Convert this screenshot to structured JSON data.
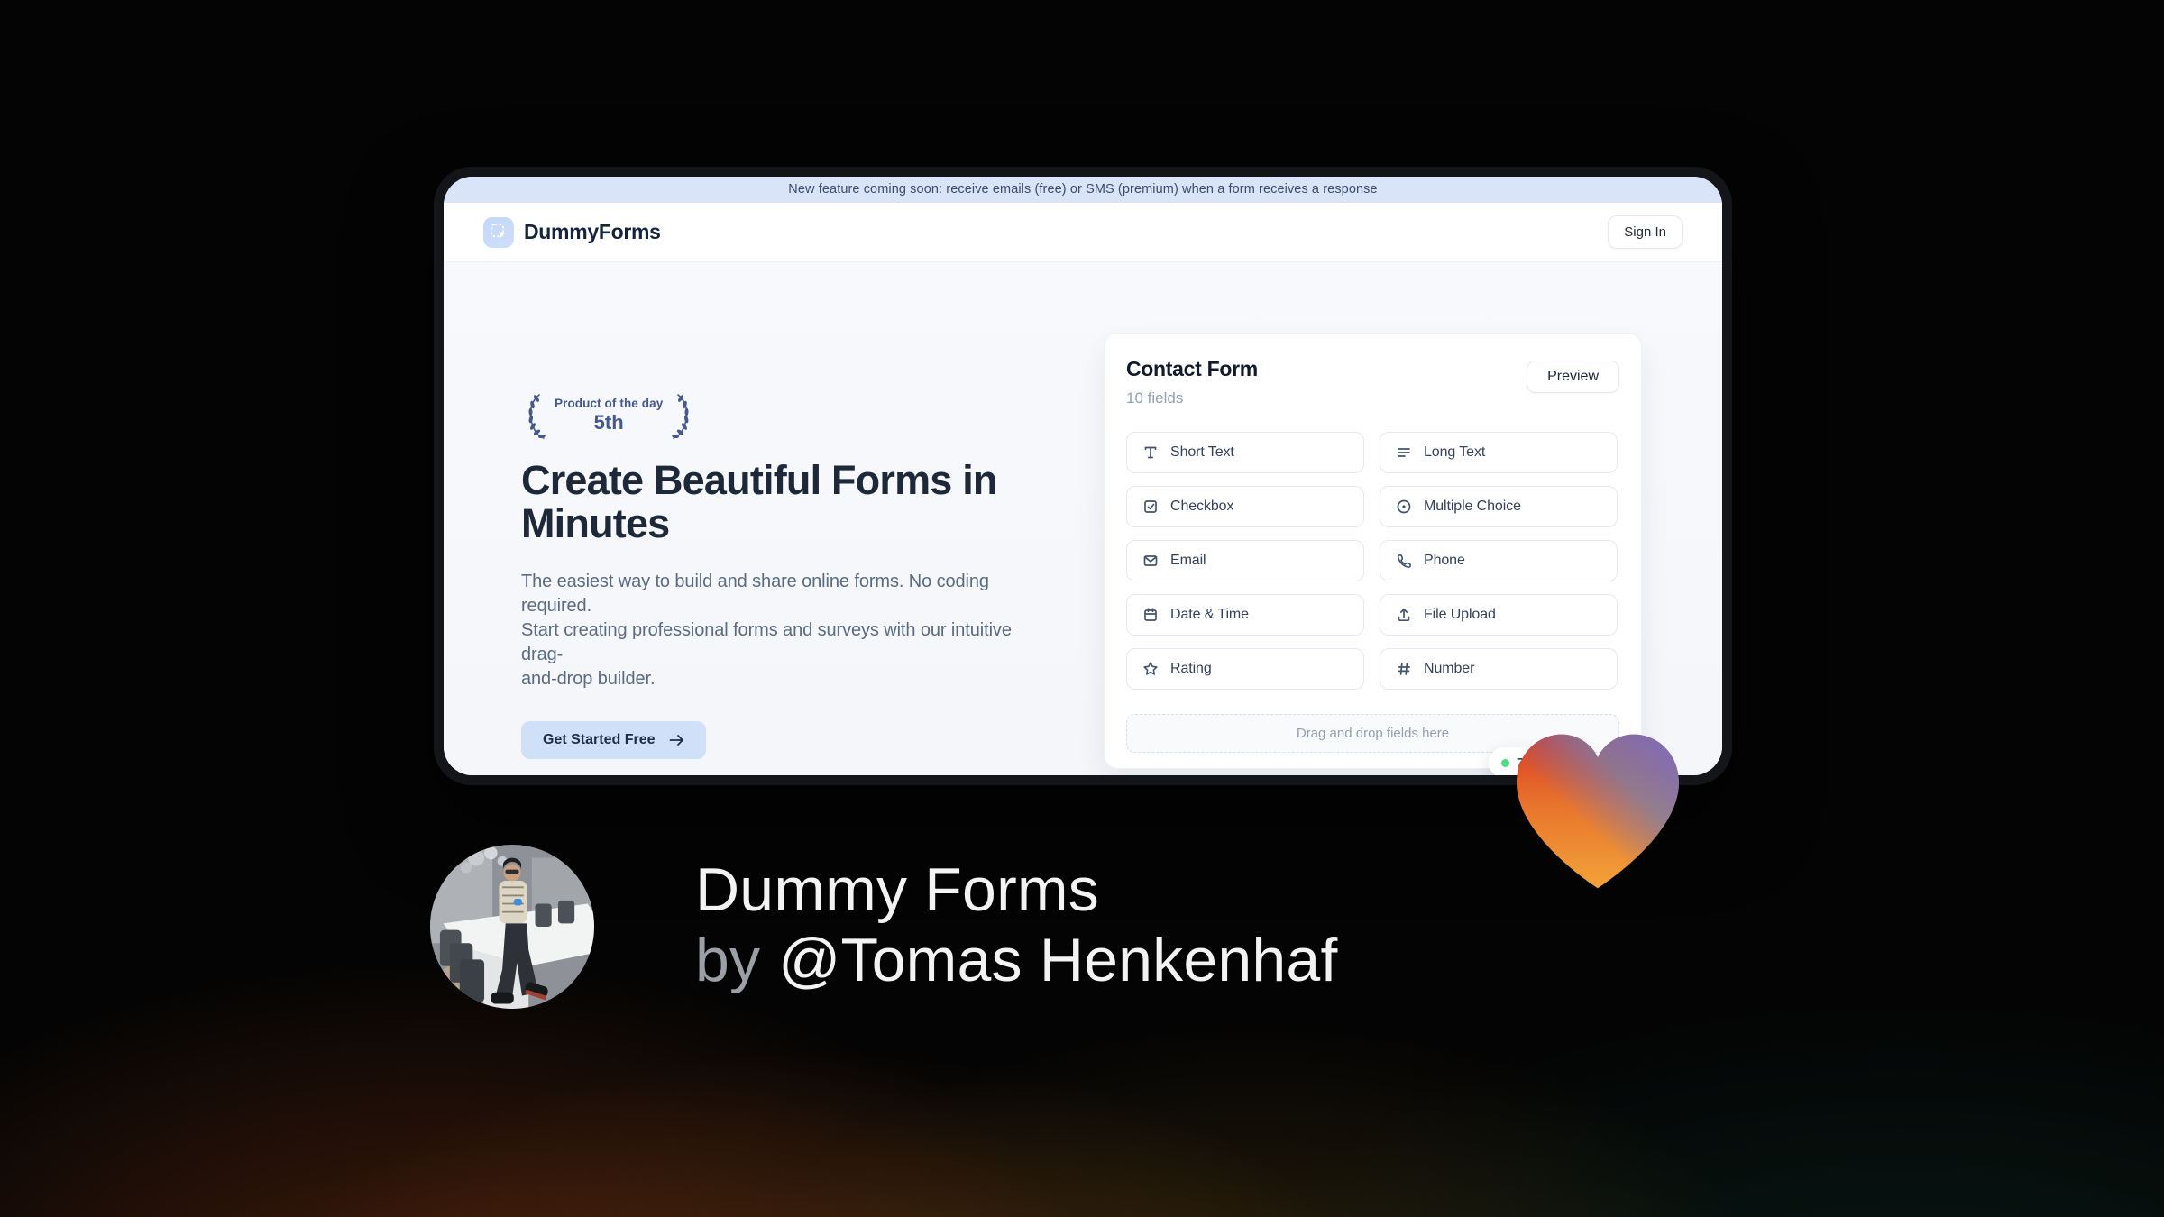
{
  "window": {
    "banner": {
      "text": "New feature coming soon: receive emails (free) or SMS (premium) when a form receives a response",
      "bg_color": "#d9e4f9",
      "text_color": "#3c4d6b"
    },
    "header": {
      "brand": "DummyForms",
      "sign_in_label": "Sign In"
    },
    "hero": {
      "award": {
        "title": "Product of the day",
        "rank": "5th",
        "color": "#46598c"
      },
      "heading": "Create Beautiful Forms in\nMinutes",
      "description": "The easiest way to build and share online forms. No coding required.\nStart creating professional forms and surveys with our intuitive drag-\nand-drop builder.",
      "cta_label": "Get Started Free",
      "cta_bg_color": "#cfe0f8"
    },
    "form_builder": {
      "title": "Contact Form",
      "subtitle": "10 fields",
      "preview_label": "Preview",
      "fields": [
        {
          "label": "Short Text",
          "icon": "short-text-icon"
        },
        {
          "label": "Long Text",
          "icon": "long-text-icon"
        },
        {
          "label": "Checkbox",
          "icon": "checkbox-icon"
        },
        {
          "label": "Multiple Choice",
          "icon": "radio-icon"
        },
        {
          "label": "Email",
          "icon": "email-icon"
        },
        {
          "label": "Phone",
          "icon": "phone-icon"
        },
        {
          "label": "Date & Time",
          "icon": "calendar-icon"
        },
        {
          "label": "File Upload",
          "icon": "upload-icon"
        },
        {
          "label": "Rating",
          "icon": "star-icon"
        },
        {
          "label": "Number",
          "icon": "hash-icon"
        }
      ],
      "dropzone_text": "Drag and drop fields here",
      "live_badge": {
        "count": "7",
        "dot_color": "#4ade80"
      }
    }
  },
  "footer": {
    "title": "Dummy Forms",
    "byline_prefix": "by",
    "author": "@Tomas Henkenhaf"
  },
  "theme": {
    "heart_colors": [
      "#d93a24",
      "#f2a338",
      "#6b74c4"
    ],
    "heading_color": "#1d2838",
    "muted_color": "#5b6b80",
    "background": "#040404"
  }
}
